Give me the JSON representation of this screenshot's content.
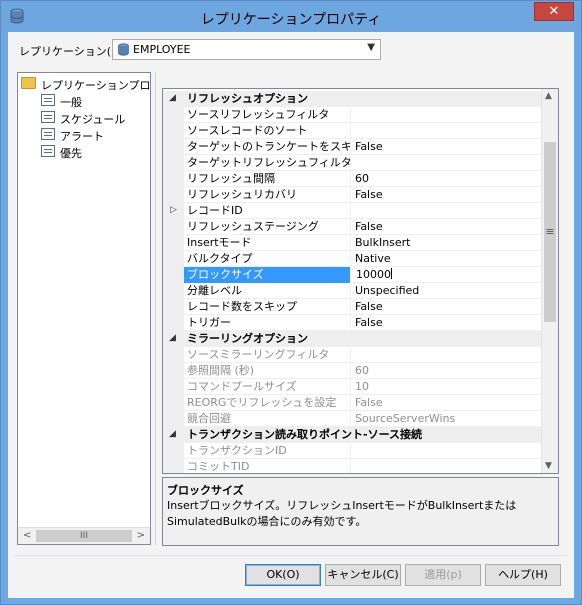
{
  "window": {
    "title": "レプリケーションプロパティ"
  },
  "replication": {
    "label": "レプリケーション(R)",
    "selected": "EMPLOYEE"
  },
  "tree": {
    "root": "レプリケーションプロパティ",
    "items": [
      {
        "label": "一般"
      },
      {
        "label": "スケジュール"
      },
      {
        "label": "アラート"
      },
      {
        "label": "優先"
      }
    ]
  },
  "grid": {
    "rows": [
      {
        "kind": "category",
        "name": "リフレッシュオプション",
        "value": ""
      },
      {
        "kind": "prop",
        "name": "ソースリフレッシュフィルタ",
        "value": ""
      },
      {
        "kind": "prop",
        "name": "ソースレコードのソート",
        "value": ""
      },
      {
        "kind": "prop",
        "name": "ターゲットのトランケートをスキップ",
        "value": "False"
      },
      {
        "kind": "prop",
        "name": "ターゲットリフレッシュフィルタ",
        "value": ""
      },
      {
        "kind": "prop",
        "name": "リフレッシュ間隔",
        "value": "60"
      },
      {
        "kind": "prop",
        "name": "リフレッシュリカバリ",
        "value": "False"
      },
      {
        "kind": "prop",
        "name": "レコードID",
        "value": "",
        "pointer": true
      },
      {
        "kind": "prop",
        "name": "リフレッシュステージング",
        "value": "False"
      },
      {
        "kind": "prop",
        "name": "Insertモード",
        "value": "BulkInsert"
      },
      {
        "kind": "prop",
        "name": "バルクタイプ",
        "value": "Native"
      },
      {
        "kind": "prop",
        "name": "ブロックサイズ",
        "value": "10000",
        "selected": true
      },
      {
        "kind": "prop",
        "name": "分離レベル",
        "value": "Unspecified"
      },
      {
        "kind": "prop",
        "name": "レコード数をスキップ",
        "value": "False"
      },
      {
        "kind": "prop",
        "name": "トリガー",
        "value": "False"
      },
      {
        "kind": "category",
        "name": "ミラーリングオプション",
        "value": ""
      },
      {
        "kind": "prop",
        "name": "ソースミラーリングフィルタ",
        "value": "",
        "disabled": true
      },
      {
        "kind": "prop",
        "name": "参照間隔 (秒)",
        "value": "60",
        "disabled": true
      },
      {
        "kind": "prop",
        "name": "コマンドプールサイズ",
        "value": "10",
        "disabled": true
      },
      {
        "kind": "prop",
        "name": "REORGでリフレッシュを設定",
        "value": "False",
        "disabled": true
      },
      {
        "kind": "prop",
        "name": "競合回避",
        "value": "SourceServerWins",
        "disabled": true
      },
      {
        "kind": "category",
        "name": "トランザクション読み取りポイント-ソース接続",
        "value": ""
      },
      {
        "kind": "prop",
        "name": "トランザクションID",
        "value": "",
        "disabled": true
      },
      {
        "kind": "prop",
        "name": "コミットTID",
        "value": "",
        "disabled": true
      }
    ]
  },
  "description": {
    "title": "ブロックサイズ",
    "text": "Insertブロックサイズ。リフレッシュInsertモードがBulkInsertまたはSimulatedBulkの場合にのみ有効です。"
  },
  "buttons": {
    "ok": "OK(O)",
    "cancel": "キャンセル(C)",
    "apply": "適用(p)",
    "help": "ヘルプ(H)"
  },
  "close_glyph": "✕",
  "scroll_thumb_glyph": "≡",
  "hscroll_thumb_glyph": "III",
  "icons": {
    "title": "database-icon",
    "combo": "database-icon",
    "tree_root": "folder-icon",
    "tree_item": "page-icon"
  },
  "colors": {
    "titlebar": "#6ea6df",
    "selection": "#3399ff",
    "close": "#c7463f"
  }
}
